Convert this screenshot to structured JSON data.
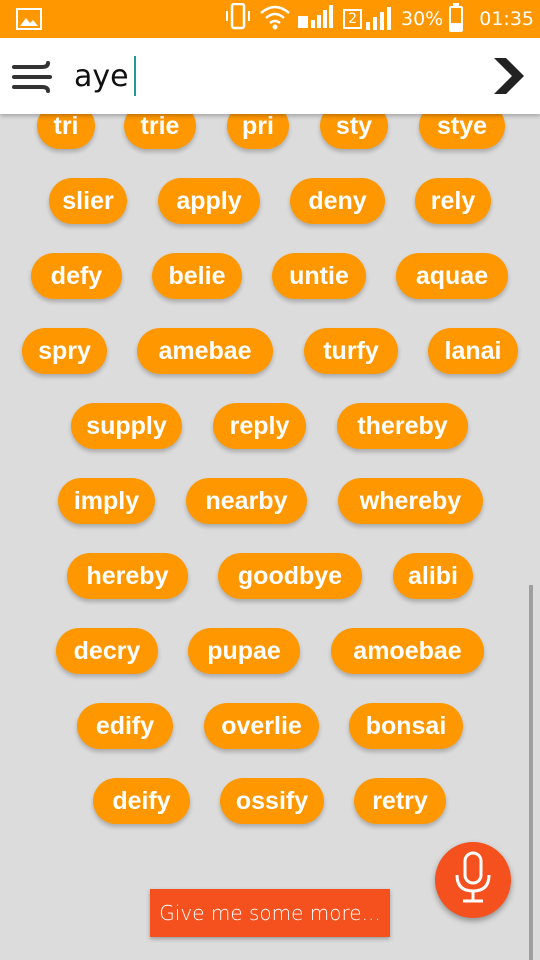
{
  "status_bar": {
    "battery_percent": "30%",
    "time": "01:35",
    "sim_badge": "2",
    "battery_level": 0.3,
    "icons": [
      "image-icon",
      "vibrate-icon",
      "wifi-icon",
      "signal-icon",
      "signal-icon",
      "battery-icon"
    ]
  },
  "search": {
    "value": "aye",
    "menu_icon": "wind-icon",
    "go_icon": "chevron-right-icon"
  },
  "words": [
    "tri",
    "trie",
    "pri",
    "sty",
    "stye",
    "slier",
    "apply",
    "deny",
    "rely",
    "defy",
    "belie",
    "untie",
    "aquae",
    "spry",
    "amebae",
    "turfy",
    "lanai",
    "supply",
    "reply",
    "thereby",
    "imply",
    "nearby",
    "whereby",
    "hereby",
    "goodbye",
    "alibi",
    "decry",
    "pupae",
    "amoebae",
    "edify",
    "overlie",
    "bonsai",
    "deify",
    "ossify",
    "retry"
  ],
  "more_button": "Give me some more...",
  "mic_icon": "microphone-icon",
  "colors": {
    "accent": "#ff9800",
    "action": "#f4511e",
    "background": "#dcdcdc"
  }
}
